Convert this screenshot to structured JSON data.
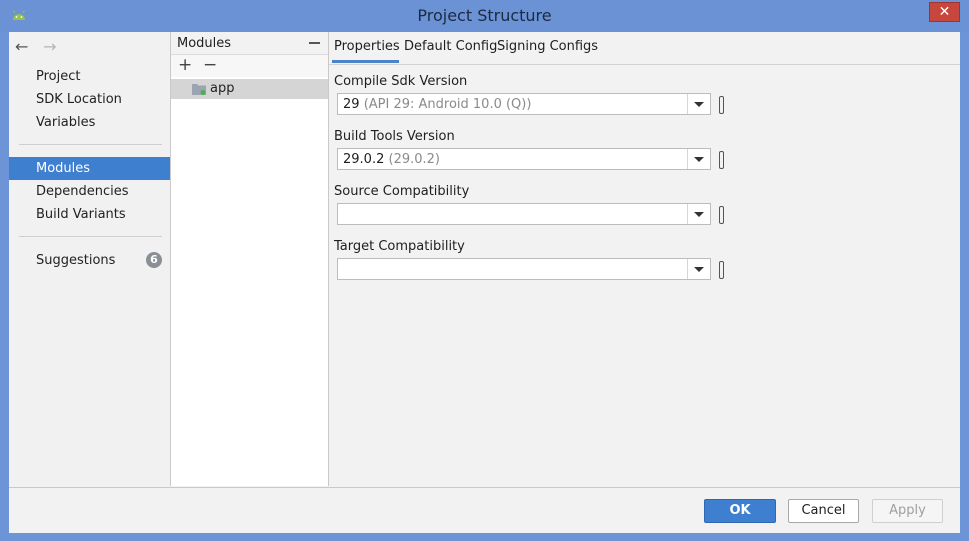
{
  "window": {
    "title": "Project Structure",
    "close_label": "✕"
  },
  "nav": {
    "back_arrow": "←",
    "forward_arrow": "→",
    "items": [
      {
        "label": "Project"
      },
      {
        "label": "SDK Location"
      },
      {
        "label": "Variables"
      },
      {
        "label": "Modules"
      },
      {
        "label": "Dependencies"
      },
      {
        "label": "Build Variants"
      },
      {
        "label": "Suggestions",
        "badge": "6"
      }
    ],
    "active": "Modules"
  },
  "modules": {
    "title": "Modules",
    "add_label": "+",
    "remove_label": "−",
    "items": [
      {
        "label": "app"
      }
    ]
  },
  "tabs": [
    {
      "label": "Properties"
    },
    {
      "label": "Default Config"
    },
    {
      "label": "Signing Configs"
    }
  ],
  "fields": {
    "compile_sdk": {
      "label": "Compile Sdk Version",
      "value": "29",
      "hint": "(API 29: Android 10.0 (Q))"
    },
    "build_tools": {
      "label": "Build Tools Version",
      "value": "29.0.2",
      "hint": "(29.0.2)"
    },
    "source_compat": {
      "label": "Source Compatibility",
      "value": "",
      "hint": ""
    },
    "target_compat": {
      "label": "Target Compatibility",
      "value": "",
      "hint": ""
    }
  },
  "buttons": {
    "ok": "OK",
    "cancel": "Cancel",
    "apply": "Apply"
  },
  "colors": {
    "accent": "#3f7fcf",
    "titlebar": "#6a92d4",
    "close": "#c7463d"
  }
}
